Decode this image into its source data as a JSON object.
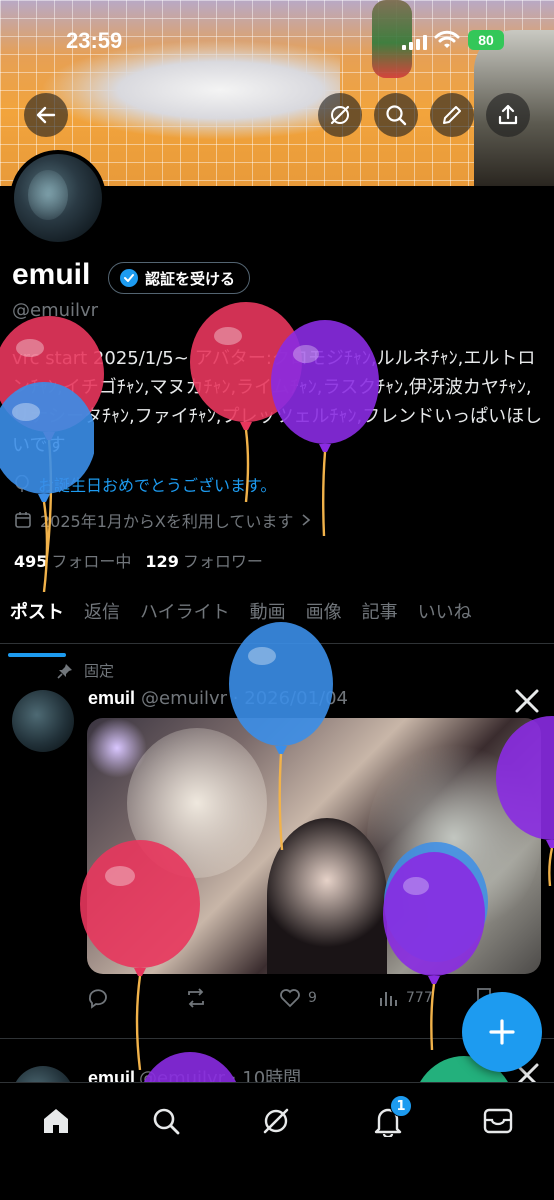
{
  "status": {
    "time": "23:59",
    "battery": "80"
  },
  "profile": {
    "name": "emuil",
    "verify_label": "認証を受ける",
    "handle": "@emuilvr",
    "bio": "vrc start 2025/1/5~ アバター:クロモジﾁｬﾝ,ルルネﾁｬﾝ,エルトロンﾁｬﾝ,イチゴﾁｬﾝ,マヌカﾁｬﾝ,ライムﾁｬﾝ,ラスクﾁｬﾝ,伊冴波カヤﾁｬﾝ,リナシータﾁｬﾝ,ファイﾁｬﾝ,プレッツェルﾁｬﾝ,フレンドいっぱいほしいです",
    "birthday_text": "お誕生日おめでとうございます。",
    "joined_text": "2025年1月からXを利用しています",
    "following_count": "495",
    "following_label": "フォロー中",
    "followers_count": "129",
    "followers_label": "フォロワー"
  },
  "tabs": [
    {
      "label": "ポスト",
      "active": true
    },
    {
      "label": "返信"
    },
    {
      "label": "ハイライト"
    },
    {
      "label": "動画"
    },
    {
      "label": "画像"
    },
    {
      "label": "記事"
    },
    {
      "label": "いいね"
    }
  ],
  "pinned_post": {
    "pinned_label": "固定",
    "author": "emuil",
    "handle_date": "@emuilvr · 2026/01/04",
    "likes": "9",
    "views": "777"
  },
  "second_post": {
    "author": "emuil",
    "handle_date": "@emuilvr · 10時間"
  },
  "nav": {
    "notifications_badge": "1"
  },
  "colors": {
    "accent": "#1d9bf0",
    "background": "#000000",
    "muted": "#71767b",
    "balloon_red": "#e8365d",
    "balloon_blue": "#3b8ee8",
    "balloon_purple": "#8a2be2",
    "balloon_green": "#27c38a"
  }
}
